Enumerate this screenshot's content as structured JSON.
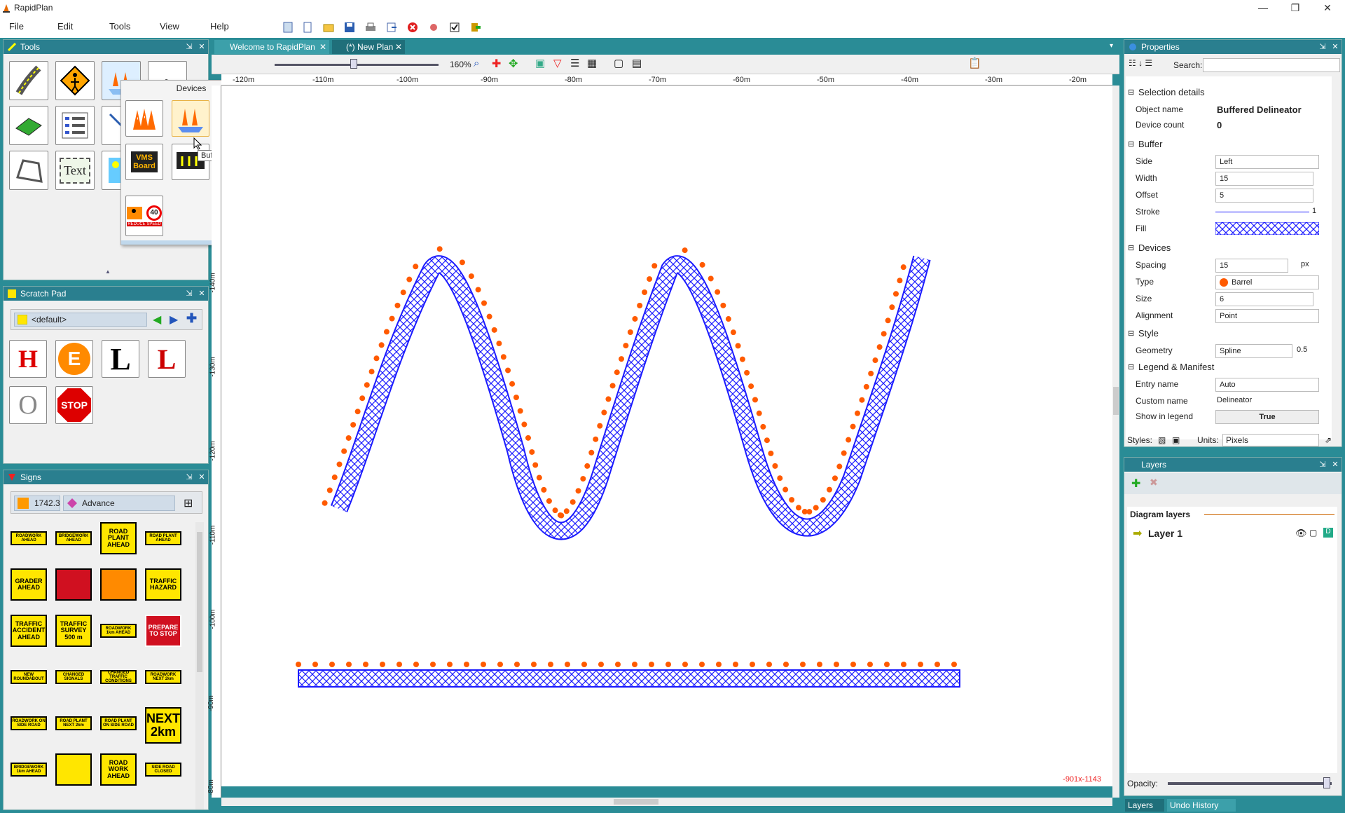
{
  "app": {
    "title": "RapidPlan"
  },
  "menu": [
    "File",
    "Edit",
    "Tools",
    "View",
    "Help"
  ],
  "toolbar_icons": [
    "new-doc-icon",
    "open-icon",
    "folder-icon",
    "save-icon",
    "print-icon",
    "export-icon",
    "close-red-icon",
    "burst-icon",
    "check-icon",
    "exit-icon"
  ],
  "tools_panel": {
    "title": "Tools"
  },
  "devices_popup": {
    "title": "Devices",
    "tooltip": "Buffered Delineator",
    "vms": "VMS\nBoard",
    "reduce_speed": "40",
    "reduce_text": "REDUCE SPEED"
  },
  "tool_text": "Text",
  "scratch": {
    "title": "Scratch Pad",
    "dropdown": "<default>",
    "letters": [
      "H",
      "E",
      "L",
      "L",
      "O"
    ],
    "stop": "STOP"
  },
  "signs": {
    "title": "Signs",
    "code": "1742.3",
    "category": "Advance",
    "items": [
      "ROADWORK AHEAD",
      "BRIDGEWORK AHEAD",
      "ROAD PLANT AHEAD",
      "ROAD PLANT AHEAD",
      "GRADER AHEAD",
      "",
      "",
      "TRAFFIC HAZARD",
      "TRAFFIC ACCIDENT AHEAD",
      "TRAFFIC SURVEY 500 m",
      "ROADWORK 1km AHEAD",
      "PREPARE TO STOP",
      "NEW ROUNDABOUT",
      "CHANGED SIGNALS",
      "CHANGED TRAFFIC CONDITIONS",
      "ROADWORK NEXT 2km",
      "ROADWORK ON SIDE ROAD",
      "ROAD PLANT NEXT 2km",
      "ROAD PLANT ON SIDE ROAD",
      "NEXT 2km",
      "BRIDGEWORK 1km AHEAD",
      "",
      "ROAD WORK AHEAD",
      "SIDE ROAD CLOSED"
    ]
  },
  "tabs": [
    {
      "label": "Welcome to RapidPlan"
    },
    {
      "label": "(*) New Plan"
    }
  ],
  "zoom": "160%",
  "ruler": {
    "h": [
      "-120m",
      "-110m",
      "-100m",
      "-90m",
      "-80m",
      "-70m",
      "-60m",
      "-50m",
      "-40m",
      "-30m",
      "-20m"
    ],
    "v": [
      "-140m",
      "-130m",
      "-120m",
      "-110m",
      "-100m",
      "-90m",
      "-80m"
    ]
  },
  "cursor_coords": "-901x-1143",
  "properties": {
    "title": "Properties",
    "search_label": "Search:",
    "sections": {
      "selection": "Selection details",
      "buffer": "Buffer",
      "devices": "Devices",
      "style": "Style",
      "legend": "Legend & Manifest"
    },
    "object_name_label": "Object name",
    "object_name": "Buffered Delineator",
    "device_count_label": "Device count",
    "device_count": "0",
    "side_label": "Side",
    "side": "Left",
    "width_label": "Width",
    "width": "15",
    "offset_label": "Offset",
    "offset": "5",
    "stroke_label": "Stroke",
    "stroke": "1",
    "fill_label": "Fill",
    "spacing_label": "Spacing",
    "spacing": "15",
    "spacing_unit": "px",
    "type_label": "Type",
    "type": "Barrel",
    "size_label": "Size",
    "size": "6",
    "alignment_label": "Alignment",
    "alignment": "Point",
    "geometry_label": "Geometry",
    "geometry": "Spline",
    "geometry_tension": "0.5",
    "entry_name_label": "Entry name",
    "entry_name": "Auto",
    "custom_name_label": "Custom name",
    "custom_name": "Delineator",
    "show_legend_label": "Show in legend",
    "show_legend": "True",
    "styles_label": "Styles:",
    "units_label": "Units:",
    "units": "Pixels"
  },
  "layers": {
    "title": "Layers",
    "diagram_layers": "Diagram layers",
    "layer1": "Layer 1",
    "opacity_label": "Opacity:",
    "opacity": 0.97,
    "bottom_tabs": [
      "Layers",
      "Undo History"
    ]
  },
  "colors": {
    "teal": "#2a8c96",
    "hatch": "#1a1aff",
    "barrel": "#ff5a00"
  }
}
